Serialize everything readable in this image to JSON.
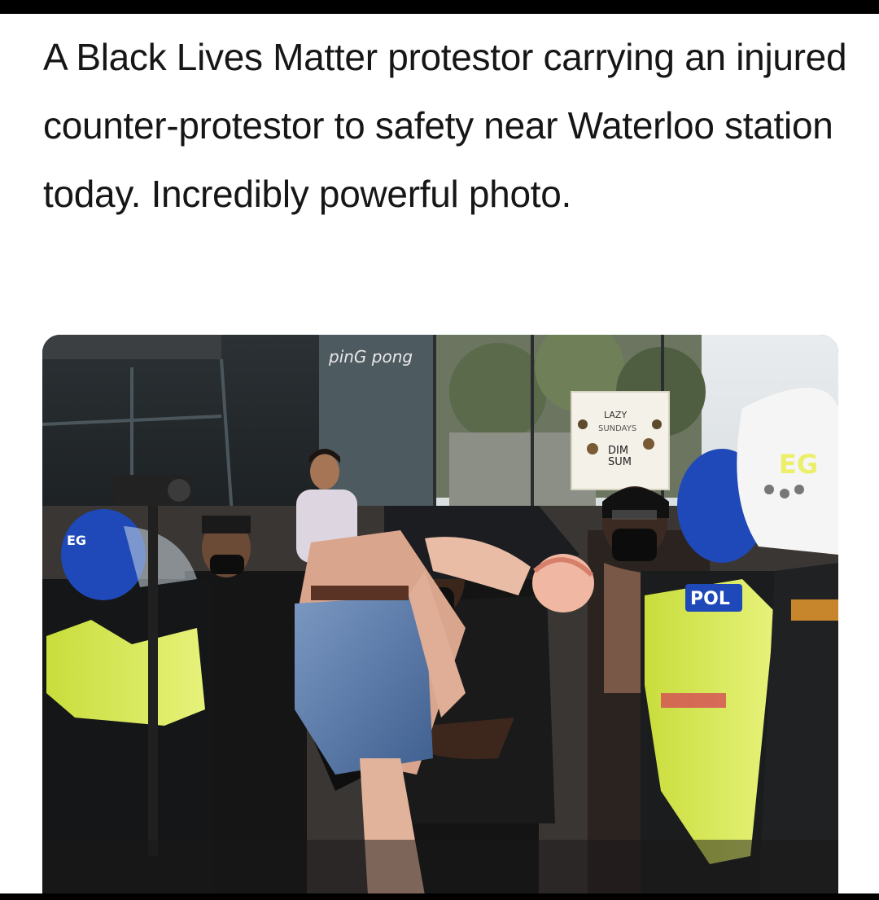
{
  "post": {
    "caption": "A Black Lives Matter protestor carrying an injured counter-protestor to safety near Waterloo station today. Incredibly powerful photo."
  },
  "photo": {
    "storefront_sign": "pinG pong",
    "poster_lines": [
      "LAZY",
      "SUNDAYS",
      "DIM",
      "SUM"
    ],
    "helmet_marking_left": "EG",
    "helmet_marking_right": "EG",
    "vest_marking": "POL"
  },
  "colors": {
    "background": "#ffffff",
    "caption_text": "#161616",
    "police_vest": "#d4e84a",
    "helmet_blue": "#1f49b8"
  }
}
